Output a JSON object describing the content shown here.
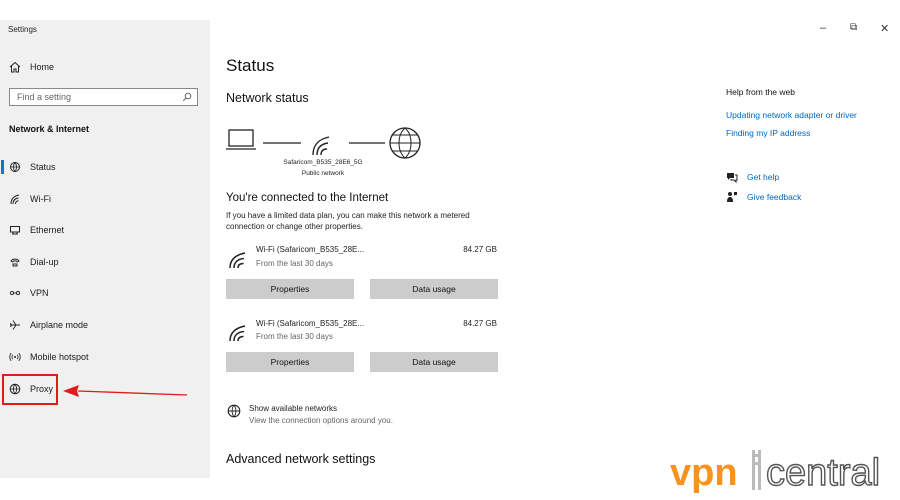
{
  "window": {
    "app_title": "Settings",
    "minimize_glyph": "–",
    "restore_glyph": "⧉",
    "close_glyph": "✕"
  },
  "sidebar": {
    "home_label": "Home",
    "search_placeholder": "Find a setting",
    "section_header": "Network & Internet",
    "items": [
      {
        "label": "Status",
        "icon": "status-icon",
        "selected": true
      },
      {
        "label": "Wi-Fi",
        "icon": "wifi-icon"
      },
      {
        "label": "Ethernet",
        "icon": "ethernet-icon"
      },
      {
        "label": "Dial-up",
        "icon": "dialup-icon"
      },
      {
        "label": "VPN",
        "icon": "vpn-icon"
      },
      {
        "label": "Airplane mode",
        "icon": "airplane-icon"
      },
      {
        "label": "Mobile hotspot",
        "icon": "hotspot-icon"
      },
      {
        "label": "Proxy",
        "icon": "globe-icon"
      }
    ]
  },
  "main": {
    "title": "Status",
    "network_status_heading": "Network status",
    "network_name": "Safaricom_B535_28E6_5G",
    "network_type": "Public network",
    "connected_title": "You're connected to the Internet",
    "metered_text": "If you have a limited data plan, you can make this network a metered connection or change other properties.",
    "connections": [
      {
        "name": "Wi-Fi (Safaricom_B535_28E...",
        "period": "From the last 30 days",
        "size": "84.27 GB",
        "properties_label": "Properties",
        "data_usage_label": "Data usage"
      },
      {
        "name": "Wi-Fi (Safaricom_B535_28E...",
        "period": "From the last 30 days",
        "size": "84.27 GB",
        "properties_label": "Properties",
        "data_usage_label": "Data usage"
      }
    ],
    "show_networks_label": "Show available networks",
    "show_networks_sub": "View the connection options around you.",
    "advanced_heading": "Advanced network settings"
  },
  "help": {
    "title": "Help from the web",
    "links": [
      "Updating network adapter or driver",
      "Finding my IP address"
    ],
    "get_help": "Get help",
    "give_feedback": "Give feedback"
  },
  "watermark": {
    "brand_left": "vpn",
    "brand_right": "central"
  },
  "colors": {
    "accent": "#0078d4",
    "link": "#0067c0",
    "highlight": "#e01b1b",
    "brand_orange": "#f7931e",
    "brand_gray": "#555555"
  }
}
